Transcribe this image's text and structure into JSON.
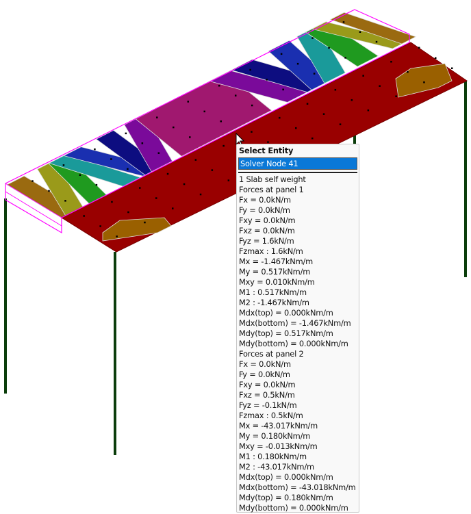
{
  "popup": {
    "title": "Select Entity",
    "selected": "Solver Node 41",
    "lines": [
      "1 Slab self weight",
      "Forces at panel 1",
      "Fx = 0.0kN/m",
      "Fy = 0.0kN/m",
      "Fxy = 0.0kN/m",
      "Fxz = 0.0kN/m",
      "Fyz = 1.6kN/m",
      "Fzmax : 1.6kN/m",
      "Mx = -1.467kNm/m",
      "My = 0.517kNm/m",
      "Mxy = 0.010kNm/m",
      "M1 : 0.517kNm/m",
      "M2 : -1.467kNm/m",
      "Mdx(top) = 0.000kNm/m",
      "Mdx(bottom) = -1.467kNm/m",
      "Mdy(top) = 0.517kNm/m",
      "Mdy(bottom) = 0.000kNm/m",
      "Forces at panel 2",
      "Fx = 0.0kN/m",
      "Fy = 0.0kN/m",
      "Fxy = 0.0kN/m",
      "Fxz = 0.5kN/m",
      "Fyz = -0.1kN/m",
      "Fzmax : 0.5kN/m",
      "Mx = -43.017kNm/m",
      "My = 0.180kNm/m",
      "Mxy = -0.013kNm/m",
      "M1 : 0.180kNm/m",
      "M2 : -43.017kNm/m",
      "Mdx(top) = 0.000kNm/m",
      "Mdx(bottom) = -43.018kNm/m",
      "Mdy(top) = 0.180kNm/m",
      "Mdy(bottom) = 0.000kNm/m"
    ]
  },
  "colors": {
    "contour": [
      "#9a6a10",
      "#9a9a1a",
      "#1f9a1f",
      "#1a9a9a",
      "#1a2fb0",
      "#0d0d80",
      "#7a0a9a",
      "#a0186f",
      "#7a0a9a",
      "#0d0d80",
      "#1a2fb0",
      "#1a9a9a",
      "#1f9a1f",
      "#9a9a1a",
      "#9a6a10"
    ],
    "slab_red": "#990000",
    "patch": "#9a6000",
    "column": "#0b3d0b",
    "outline": "#ff00ff",
    "selection": "#0a78d7"
  }
}
